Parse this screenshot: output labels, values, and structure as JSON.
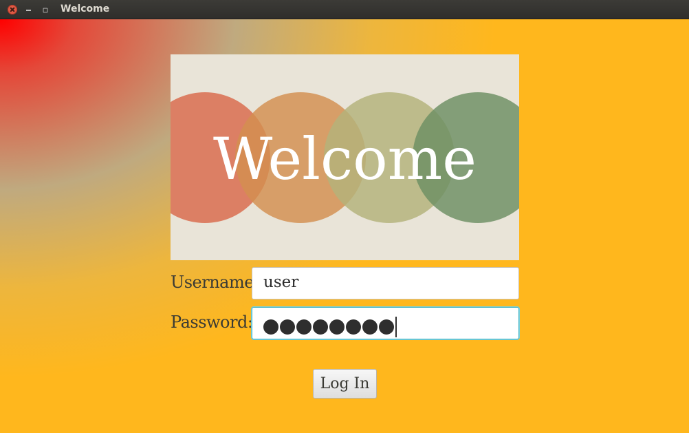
{
  "window": {
    "title": "Welcome"
  },
  "banner": {
    "title": "Welcome",
    "colors": [
      "#d9694a",
      "#d38f4f",
      "#b3b27a",
      "#6d8f63"
    ],
    "background": "#e9e4d8"
  },
  "form": {
    "username_label": "Username:",
    "username_value": "user",
    "password_label": "Password:",
    "password_mask_count": 8,
    "login_label": "Log In"
  },
  "colors": {
    "background_main": "#ffb71d",
    "background_corner": "#ff0000",
    "focus_ring": "#3fb3c4"
  }
}
